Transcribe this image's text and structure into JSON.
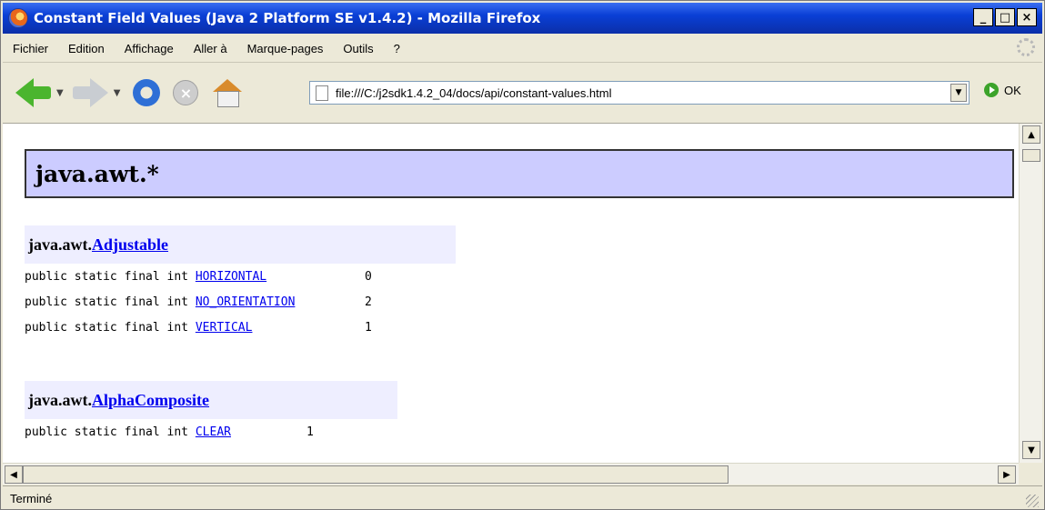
{
  "window": {
    "title": "Constant Field Values (Java 2 Platform SE v1.4.2) - Mozilla Firefox",
    "controls": {
      "minimize": "_",
      "maximize": "□",
      "close": "×"
    }
  },
  "menu": [
    "Fichier",
    "Edition",
    "Affichage",
    "Aller à",
    "Marque-pages",
    "Outils",
    "?"
  ],
  "toolbar": {
    "url": "file:///C:/j2sdk1.4.2_04/docs/api/constant-values.html",
    "go_label": "OK",
    "icons": [
      "back-icon",
      "forward-icon",
      "reload-icon",
      "stop-icon",
      "home-icon"
    ]
  },
  "content": {
    "package_title": "java.awt.*",
    "classes": [
      {
        "prefix": "java.awt.",
        "name": "Adjustable",
        "constants": [
          {
            "modifiers": "public static final int ",
            "name": "HORIZONTAL",
            "value": "0"
          },
          {
            "modifiers": "public static final int ",
            "name": "NO_ORIENTATION",
            "value": "2"
          },
          {
            "modifiers": "public static final int ",
            "name": "VERTICAL",
            "value": "1"
          }
        ]
      },
      {
        "prefix": "java.awt.",
        "name": "AlphaComposite",
        "constants": [
          {
            "modifiers": "public static final int ",
            "name": "CLEAR",
            "value": "1"
          }
        ]
      }
    ]
  },
  "status": {
    "text": "Terminé"
  }
}
